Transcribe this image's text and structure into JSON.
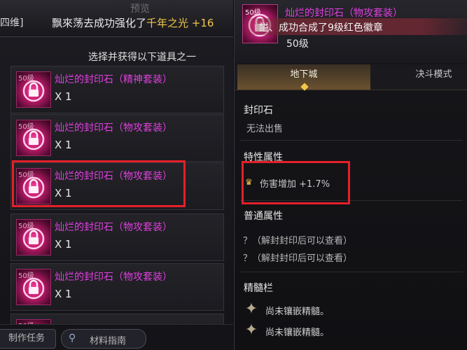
{
  "left_panel": {
    "top_bar": {
      "fragment_text": "四维]",
      "announcement_prefix": "飘來荡去成功强化了",
      "announcement_item": "千年之光 +16",
      "ghost_title": "预览"
    },
    "subtitle": "选择并获得以下道具之一",
    "items": [
      {
        "level": "50级",
        "name": "灿烂的封印石（精神套装）",
        "qty": "X 1"
      },
      {
        "level": "50级",
        "name": "灿烂的封印石（物攻套装）",
        "qty": "X 1"
      },
      {
        "level": "50级",
        "name": "灿烂的封印石（物攻套装）",
        "qty": "X 1"
      },
      {
        "level": "50级",
        "name": "灿烂的封印石（物攻套装）",
        "qty": "X 1"
      },
      {
        "level": "50级",
        "name": "灿烂的封印石（物攻套装）",
        "qty": "X 1"
      },
      {
        "level": "50级",
        "name": "",
        "qty": ""
      }
    ],
    "bottom_buttons": {
      "task": "制作任务",
      "guide": "材料指南"
    }
  },
  "right_panel": {
    "header": {
      "icon_level": "50级",
      "title": "灿烂的封印石（物攻套装）",
      "toast": "謚、成功合成了9级红色徽章",
      "level": "50级"
    },
    "tabs": [
      {
        "label": "地下城",
        "active": true
      },
      {
        "label": "决斗模式",
        "active": false
      }
    ],
    "category": "封印石",
    "sale_status": "无法出售",
    "trait_heading": "特性属性",
    "trait_value": "伤害增加 +1.7%",
    "normal_heading": "普通属性",
    "normal_lines": [
      "？（解封封印后可以查看）",
      "？（解封封印后可以查看）"
    ],
    "essence_heading": "精髓栏",
    "essence_slots": [
      "尚未镶嵌精髓。",
      "尚未镶嵌精髓。"
    ]
  },
  "colors": {
    "item_name": "#e23ee0",
    "highlight": "#e4202a",
    "gold": "#f2c649"
  },
  "icons": {
    "lock": "lock-icon",
    "crown": "crown-icon",
    "star": "star-icon",
    "search": "search-icon"
  }
}
